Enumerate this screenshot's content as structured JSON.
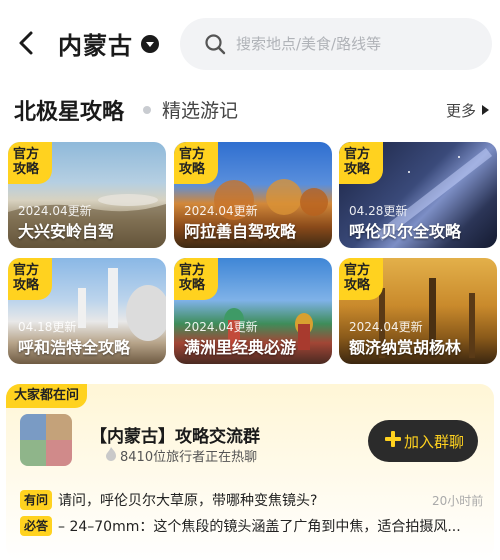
{
  "header": {
    "city": "内蒙古",
    "search_placeholder": "搜索地点/美食/路线等"
  },
  "section": {
    "title": "北极星攻略",
    "subtitle": "精选游记",
    "more_label": "更多"
  },
  "cards": [
    {
      "badge_line1": "官方",
      "badge_line2": "攻略",
      "date": "2024.04更新",
      "title": "大兴安岭自驾"
    },
    {
      "badge_line1": "官方",
      "badge_line2": "攻略",
      "date": "2024.04更新",
      "title": "阿拉善自驾攻略"
    },
    {
      "badge_line1": "官方",
      "badge_line2": "攻略",
      "date": "04.28更新",
      "title": "呼伦贝尔全攻略"
    },
    {
      "badge_line1": "官方",
      "badge_line2": "攻略",
      "date": "04.18更新",
      "title": "呼和浩特全攻略"
    },
    {
      "badge_line1": "官方",
      "badge_line2": "攻略",
      "date": "2024.04更新",
      "title": "满洲里经典必游"
    },
    {
      "badge_line1": "官方",
      "badge_line2": "攻略",
      "date": "2024.04更新",
      "title": "额济纳赏胡杨林"
    }
  ],
  "discussion": {
    "badge": "大家都在问",
    "group_title": "【内蒙古】攻略交流群",
    "group_subtitle": "8410位旅行者正在热聊",
    "join_label": "加入群聊",
    "question_tag": "有问",
    "question": "请问，呼伦贝尔大草原，带哪种变焦镜头?",
    "question_time": "20小时前",
    "answer_tag": "必答",
    "answer": "– 24–70mm：这个焦段的镜头涵盖了广角到中焦，适合拍摄风..."
  },
  "colors": {
    "accent": "#ffd21f",
    "dark_button": "#2b2b2b",
    "search_bg": "#f2f3f5"
  }
}
